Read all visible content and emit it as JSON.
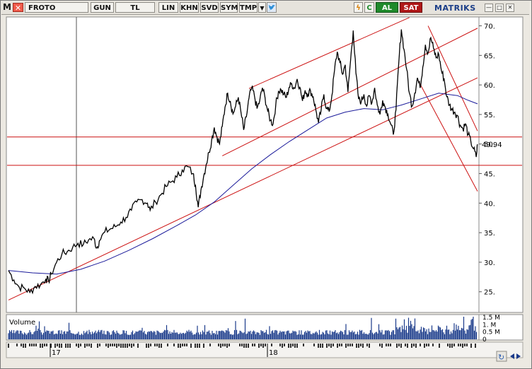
{
  "toolbar": {
    "logo": "M",
    "symbol": "FROTO",
    "buttons": [
      "GUN",
      "TL",
      "LIN",
      "KHN",
      "SVD",
      "SYM",
      "TMP"
    ],
    "lightning_icon": "lightning-icon",
    "refresh_icon": "refresh-icon",
    "buy_label": "AL",
    "sell_label": "SAT",
    "brand": "MATRIKS",
    "window_buttons": [
      "—",
      "□",
      "✕"
    ]
  },
  "colors": {
    "price": "#000000",
    "moving_average": "#1a1a9a",
    "trend_lines": "#cc1111",
    "volume": "#1a3a8a",
    "chart_bg": "#ffffff"
  },
  "chart_data": [
    {
      "type": "line",
      "name": "price-chart",
      "ylim": [
        21.5,
        71.5
      ],
      "yticks": [
        25,
        30,
        35,
        40,
        45,
        50,
        55,
        60,
        65,
        70
      ],
      "ytick_labels": [
        "25.",
        "30.",
        "35.",
        "40.",
        "45.",
        "50.",
        "55.",
        "60.",
        "65.",
        "70."
      ],
      "last_price_label": "49.94",
      "x_labels": [
        "17",
        "18"
      ],
      "price_path": [
        [
          0,
          28.6
        ],
        [
          4,
          27.0
        ],
        [
          8,
          25.8
        ],
        [
          12,
          25.6
        ],
        [
          16,
          24.9
        ],
        [
          20,
          25.9
        ],
        [
          24,
          26.2
        ],
        [
          28,
          27.2
        ],
        [
          30,
          26.8
        ],
        [
          32,
          28.0
        ],
        [
          36,
          30.0
        ],
        [
          40,
          31.4
        ],
        [
          44,
          31.8
        ],
        [
          48,
          32.5
        ],
        [
          52,
          33.2
        ],
        [
          56,
          33.0
        ],
        [
          60,
          33.8
        ],
        [
          64,
          34.0
        ],
        [
          66,
          32.4
        ],
        [
          68,
          33.6
        ],
        [
          72,
          35.1
        ],
        [
          76,
          35.6
        ],
        [
          80,
          36.0
        ],
        [
          84,
          36.8
        ],
        [
          88,
          37.6
        ],
        [
          92,
          38.8
        ],
        [
          96,
          40.2
        ],
        [
          100,
          40.6
        ],
        [
          104,
          40.0
        ],
        [
          106,
          38.8
        ],
        [
          110,
          40.2
        ],
        [
          114,
          41.4
        ],
        [
          118,
          42.8
        ],
        [
          122,
          43.6
        ],
        [
          126,
          44.4
        ],
        [
          130,
          45.6
        ],
        [
          134,
          46.2
        ],
        [
          138,
          45.0
        ],
        [
          140,
          43.0
        ],
        [
          142,
          39.3
        ],
        [
          144,
          42.2
        ],
        [
          146,
          44.5
        ],
        [
          148,
          46.6
        ],
        [
          150,
          48.6
        ],
        [
          152,
          50.6
        ],
        [
          154,
          52.8
        ],
        [
          156,
          51.2
        ],
        [
          158,
          50.0
        ],
        [
          160,
          53.0
        ],
        [
          162,
          56.2
        ],
        [
          164,
          58.6
        ],
        [
          166,
          57.2
        ],
        [
          168,
          55.1
        ],
        [
          170,
          56.4
        ],
        [
          172,
          57.9
        ],
        [
          174,
          55.3
        ],
        [
          176,
          52.4
        ],
        [
          178,
          54.6
        ],
        [
          180,
          57.8
        ],
        [
          182,
          59.5
        ],
        [
          184,
          58.2
        ],
        [
          186,
          56.0
        ],
        [
          188,
          57.3
        ],
        [
          190,
          59.5
        ],
        [
          192,
          57.8
        ],
        [
          194,
          55.6
        ],
        [
          196,
          54.0
        ],
        [
          198,
          53.4
        ],
        [
          200,
          56.6
        ],
        [
          202,
          58.9
        ],
        [
          204,
          59.2
        ],
        [
          206,
          58.4
        ],
        [
          208,
          57.9
        ],
        [
          210,
          59.6
        ],
        [
          212,
          60.2
        ],
        [
          214,
          59.4
        ],
        [
          216,
          61.0
        ],
        [
          218,
          59.6
        ],
        [
          220,
          57.3
        ],
        [
          222,
          59.1
        ],
        [
          224,
          58.4
        ],
        [
          226,
          59.0
        ],
        [
          228,
          58.0
        ],
        [
          230,
          55.8
        ],
        [
          232,
          53.6
        ],
        [
          234,
          55.8
        ],
        [
          236,
          58.4
        ],
        [
          238,
          56.0
        ],
        [
          240,
          55.5
        ],
        [
          242,
          58.2
        ],
        [
          244,
          62.5
        ],
        [
          246,
          65.6
        ],
        [
          248,
          63.8
        ],
        [
          250,
          61.8
        ],
        [
          252,
          63.4
        ],
        [
          254,
          58.8
        ],
        [
          256,
          64.2
        ],
        [
          258,
          69.2
        ],
        [
          260,
          62.0
        ],
        [
          262,
          57.6
        ],
        [
          264,
          57.2
        ],
        [
          266,
          58.4
        ],
        [
          268,
          56.4
        ],
        [
          270,
          58.2
        ],
        [
          272,
          57.0
        ],
        [
          274,
          59.5
        ],
        [
          276,
          56.6
        ],
        [
          278,
          55.0
        ],
        [
          280,
          57.4
        ],
        [
          282,
          56.2
        ],
        [
          284,
          55.0
        ],
        [
          286,
          53.4
        ],
        [
          288,
          51.6
        ],
        [
          290,
          55.8
        ],
        [
          292,
          63.6
        ],
        [
          294,
          69.4
        ],
        [
          296,
          66.0
        ],
        [
          298,
          62.6
        ],
        [
          300,
          58.6
        ],
        [
          302,
          56.4
        ],
        [
          304,
          58.6
        ],
        [
          306,
          61.2
        ],
        [
          308,
          59.5
        ],
        [
          310,
          63.0
        ],
        [
          312,
          66.8
        ],
        [
          314,
          65.4
        ],
        [
          316,
          68.0
        ],
        [
          318,
          66.2
        ],
        [
          320,
          64.6
        ],
        [
          322,
          65.2
        ],
        [
          324,
          62.4
        ],
        [
          326,
          61.0
        ],
        [
          328,
          58.0
        ],
        [
          330,
          56.6
        ],
        [
          332,
          55.8
        ],
        [
          334,
          55.4
        ],
        [
          336,
          54.8
        ],
        [
          338,
          53.2
        ],
        [
          340,
          52.6
        ],
        [
          342,
          53.4
        ],
        [
          344,
          51.6
        ],
        [
          346,
          50.4
        ],
        [
          348,
          49.2
        ],
        [
          350,
          47.8
        ],
        [
          351,
          49.94
        ]
      ],
      "ma_path": [
        [
          0,
          28.6
        ],
        [
          18,
          28.2
        ],
        [
          36,
          28.0
        ],
        [
          54,
          28.8
        ],
        [
          72,
          30.2
        ],
        [
          90,
          32.0
        ],
        [
          108,
          34.0
        ],
        [
          126,
          36.2
        ],
        [
          140,
          38.0
        ],
        [
          154,
          40.2
        ],
        [
          168,
          43.0
        ],
        [
          182,
          45.8
        ],
        [
          196,
          48.2
        ],
        [
          210,
          50.4
        ],
        [
          224,
          52.4
        ],
        [
          238,
          54.4
        ],
        [
          252,
          55.4
        ],
        [
          266,
          56.0
        ],
        [
          280,
          55.8
        ],
        [
          294,
          56.6
        ],
        [
          308,
          57.6
        ],
        [
          322,
          58.6
        ],
        [
          336,
          58.2
        ],
        [
          344,
          57.4
        ],
        [
          351,
          56.8
        ]
      ],
      "trend_channel": {
        "lower": [
          [
            0,
            23.6
          ],
          [
            351,
            61.2
          ]
        ],
        "middle": [
          [
            160,
            48.0
          ],
          [
            351,
            69.6
          ]
        ],
        "upper": [
          [
            180,
            59.4
          ],
          [
            300,
            71.4
          ]
        ],
        "down_upper": [
          [
            314,
            70.0
          ],
          [
            351,
            52.2
          ]
        ],
        "down_lower": [
          [
            306,
            61.0
          ],
          [
            351,
            42.0
          ]
        ],
        "horizontal_1": 51.2,
        "horizontal_2": 46.4
      }
    },
    {
      "type": "bar",
      "name": "volume-chart",
      "title": "Volume",
      "ylim": [
        0,
        1.6
      ],
      "ytick_labels": [
        "1.5 M",
        "1. M",
        "0.5 M",
        "0"
      ],
      "yticks": [
        1.5,
        1.0,
        0.5,
        0
      ]
    }
  ]
}
